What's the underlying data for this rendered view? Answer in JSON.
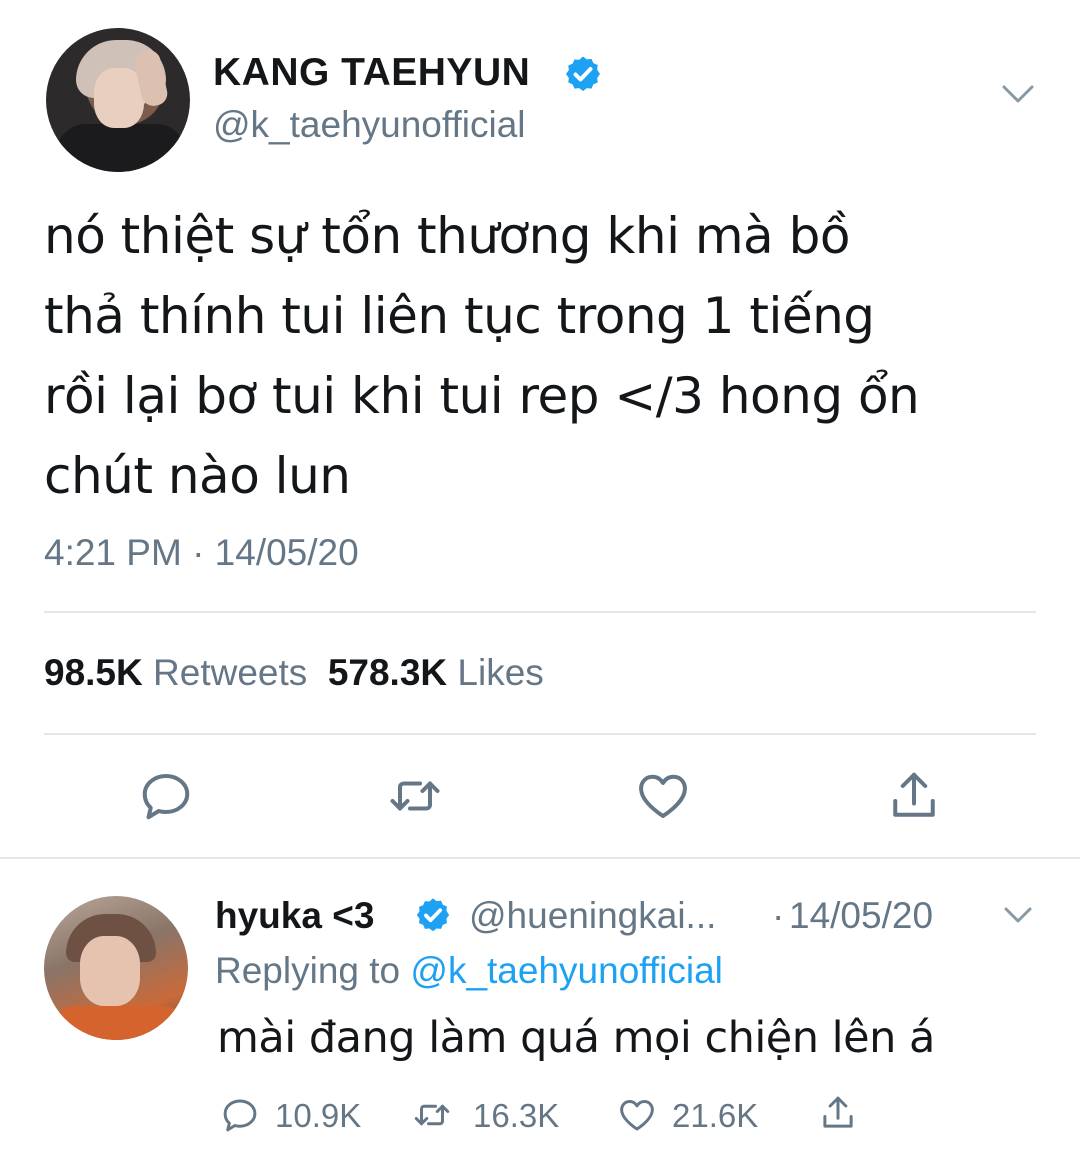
{
  "main_tweet": {
    "display_name": "KANG TAEHYUN",
    "handle": "@k_taehyunofficial",
    "text": "nó thiệt sự tổn thương khi mà bồ\nthả thính tui liên tục trong 1 tiếng\nrồi lại bơ tui khi tui rep </3 hong ổn\nchút nào lun",
    "timestamp": "4:21 PM · 14/05/20",
    "retweets_count": "98.5K",
    "retweets_label": "Retweets",
    "likes_count": "578.3K",
    "likes_label": "Likes"
  },
  "reply": {
    "display_name": "hyuka <3",
    "handle": "@hueningkai...",
    "separator": "·",
    "date": "14/05/20",
    "replying_prefix": "Replying to",
    "replying_to": "@k_taehyunofficial",
    "text": "mài đang làm quá mọi chiện lên á",
    "reply_count": "10.9K",
    "retweet_count": "16.3K",
    "like_count": "21.6K"
  },
  "colors": {
    "text_primary": "#14171a",
    "text_secondary": "#657786",
    "accent": "#1da1f2",
    "divider": "#e1e8ed"
  },
  "icons": [
    "verified-badge-icon",
    "chevron-down-icon",
    "reply-icon",
    "retweet-icon",
    "like-icon",
    "share-icon"
  ]
}
